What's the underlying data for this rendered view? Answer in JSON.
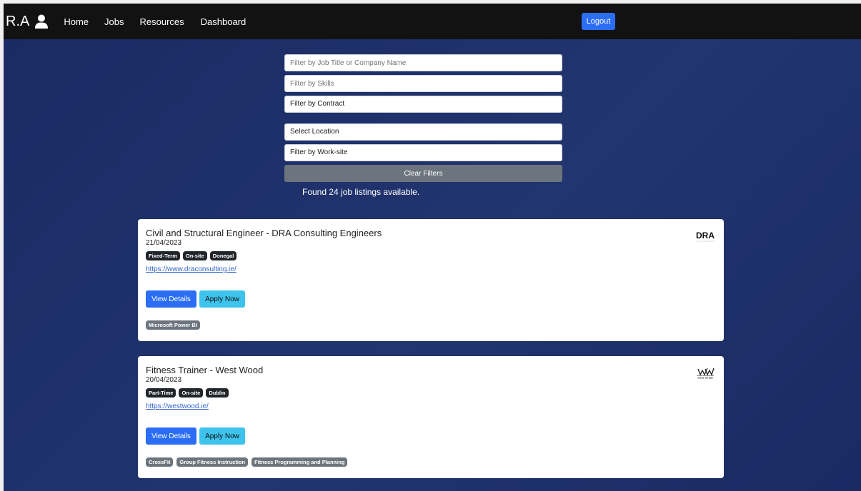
{
  "nav": {
    "brand": "R.A",
    "links": [
      "Home",
      "Jobs",
      "Resources",
      "Dashboard"
    ],
    "logout_label": "Logout"
  },
  "filters": {
    "title_placeholder": "Filter by Job Title or Company Name",
    "skills_placeholder": "Filter by Skills",
    "contract_value": "Filter by Contract",
    "location_value": "Select Location",
    "worksite_value": "Filter by Work-site",
    "clear_label": "Clear Filters"
  },
  "found_text": "Found 24 job listings available.",
  "jobs": [
    {
      "title": "Civil and Structural Engineer - DRA Consulting Engineers",
      "date": "21/04/2023",
      "tags": [
        "Fixed-Term",
        "On-site",
        "Donegal"
      ],
      "url": "https://www.draconsulting.ie/",
      "view_label": "View Details",
      "apply_label": "Apply Now",
      "skills": [
        "Microsoft Power BI"
      ],
      "logo_text": "DRA"
    },
    {
      "title": "Fitness Trainer - West Wood",
      "date": "20/04/2023",
      "tags": [
        "Part-Time",
        "On-site",
        "Dublin"
      ],
      "url": "https://westwood.ie/",
      "view_label": "View Details",
      "apply_label": "Apply Now",
      "skills": [
        "CrossFit",
        "Group Fitness Instruction",
        "Fitness Programming and Planning"
      ],
      "logo_text": "WEST WOOD"
    }
  ],
  "colors": {
    "navbar": "#121212",
    "background": "#1e2f6a",
    "primary": "#2b6ef5",
    "info": "#3dc3ec",
    "secondary": "#6c757d",
    "dark_badge": "#212529"
  }
}
